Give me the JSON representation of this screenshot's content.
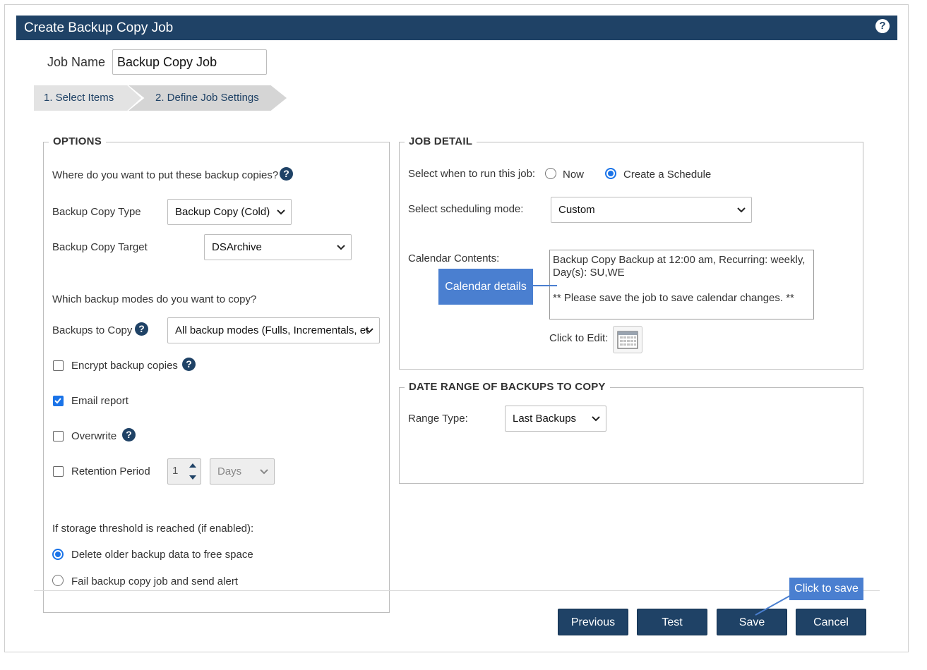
{
  "window": {
    "title": "Create Backup Copy Job"
  },
  "job_name": {
    "label": "Job Name",
    "value": "Backup Copy Job"
  },
  "steps": [
    {
      "label": "1. Select Items"
    },
    {
      "label": "2. Define Job Settings"
    }
  ],
  "options": {
    "legend": "OPTIONS",
    "where_question": "Where do you want to put these backup copies?",
    "copy_type": {
      "label": "Backup Copy Type",
      "value": "Backup Copy (Cold)"
    },
    "copy_target": {
      "label": "Backup Copy Target",
      "value": "DSArchive"
    },
    "modes_question": "Which backup modes do you want to copy?",
    "backups_to_copy": {
      "label": "Backups to Copy",
      "value": "All backup modes (Fulls, Incrementals, et"
    },
    "encrypt": {
      "label": "Encrypt backup copies",
      "checked": false
    },
    "email": {
      "label": "Email report",
      "checked": true
    },
    "overwrite": {
      "label": "Overwrite",
      "checked": false
    },
    "retention": {
      "label": "Retention Period",
      "checked": false,
      "value": "1",
      "unit": "Days"
    },
    "threshold_question": "If storage threshold is reached (if enabled):",
    "threshold_options": [
      {
        "label": "Delete older backup data to free space",
        "selected": true
      },
      {
        "label": "Fail backup copy job and send alert",
        "selected": false
      }
    ]
  },
  "job_detail": {
    "legend": "JOB DETAIL",
    "run_label": "Select when to run this job:",
    "run_options": [
      {
        "label": "Now",
        "selected": false
      },
      {
        "label": "Create a Schedule",
        "selected": true
      }
    ],
    "mode": {
      "label": "Select scheduling mode:",
      "value": "Custom"
    },
    "calendar": {
      "label": "Calendar Contents:",
      "line1": "Backup Copy Backup at 12:00 am, Recurring: weekly,",
      "line2": "Day(s): SU,WE",
      "line3": "** Please save the job to save calendar changes. **"
    },
    "edit_label": "Click to Edit:"
  },
  "date_range": {
    "legend": "DATE RANGE OF BACKUPS TO COPY",
    "range_type": {
      "label": "Range Type:",
      "value": "Last Backups"
    }
  },
  "callouts": {
    "calendar": "Calendar details",
    "save": "Click to save"
  },
  "buttons": {
    "previous": "Previous",
    "test": "Test",
    "save": "Save",
    "cancel": "Cancel"
  },
  "colors": {
    "header": "#1f4266",
    "accent": "#1a73e8",
    "callout": "#4a7fd0"
  }
}
